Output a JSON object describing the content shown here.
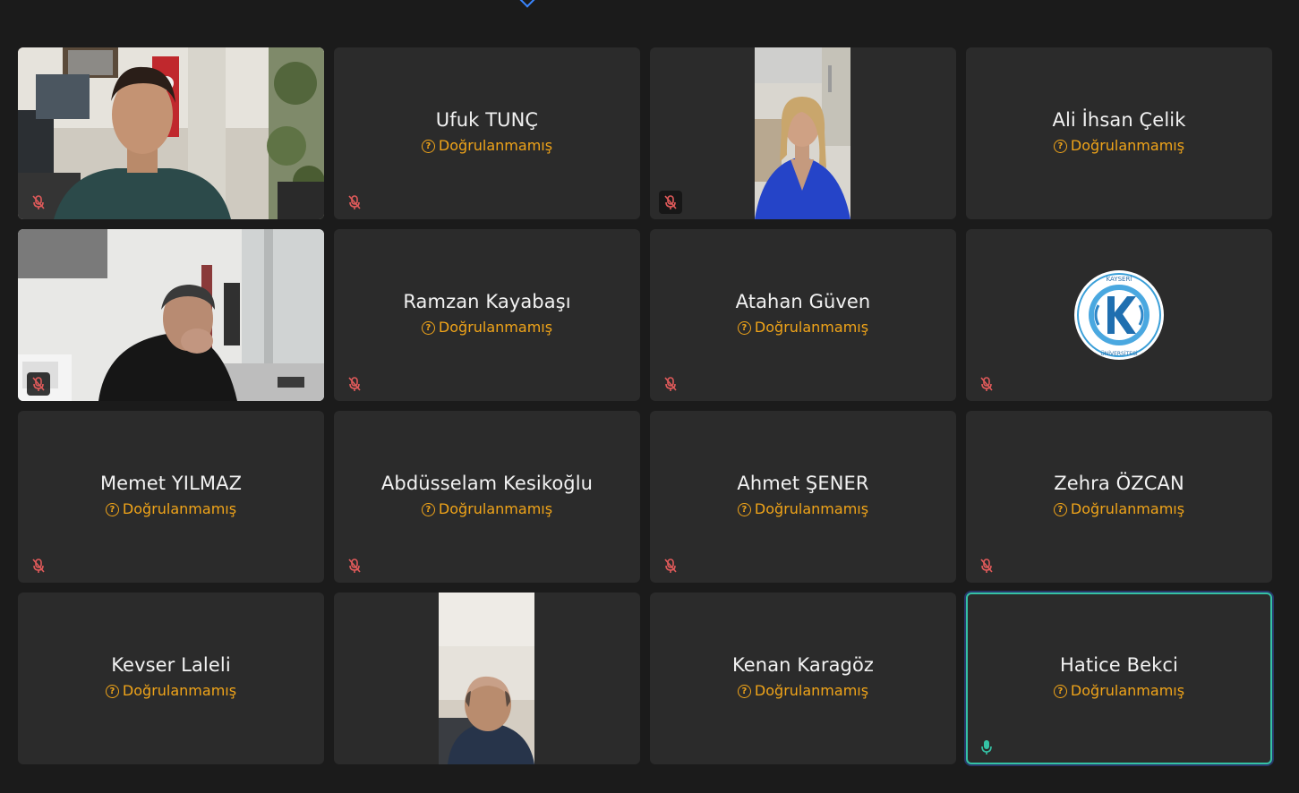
{
  "unverified_label": "Doğrulanmamış",
  "colors": {
    "background": "#1b1b1b",
    "tile": "#2b2b2b",
    "unverified": "#f0a419",
    "muted_mic": "#e05a5a",
    "active_mic": "#35c2a5",
    "active_border": "#35c2a5"
  },
  "participants": [
    {
      "name": "",
      "video": "man-office-flag",
      "mic": "muted-icon"
    },
    {
      "name": "Ufuk TUNÇ",
      "status": "Doğrulanmamış",
      "mic": "muted-icon"
    },
    {
      "name": "",
      "video": "woman-blue-dress-portrait",
      "mic": "muted-icon"
    },
    {
      "name": "Ali İhsan Çelik",
      "status": "Doğrulanmamış",
      "mic": "none"
    },
    {
      "name": "",
      "video": "man-black-shirt-office",
      "mic": "muted-icon"
    },
    {
      "name": "Ramzan Kayabaşı",
      "status": "Doğrulanmamış",
      "mic": "muted-icon"
    },
    {
      "name": "Atahan Güven",
      "status": "Doğrulanmamış",
      "mic": "muted-icon"
    },
    {
      "name": "",
      "logo": "kayseri-universitesi-logo",
      "logo_text": "KAYSERİ ÜNİVERSİTESİ",
      "mic": "muted-icon"
    },
    {
      "name": "Memet YILMAZ",
      "status": "Doğrulanmamış",
      "mic": "muted-icon"
    },
    {
      "name": "Abdüsselam Kesikoğlu",
      "status": "Doğrulanmamış",
      "mic": "muted-icon"
    },
    {
      "name": "Ahmet ŞENER",
      "status": "Doğrulanmamış",
      "mic": "muted-icon"
    },
    {
      "name": "Zehra ÖZCAN",
      "status": "Doğrulanmamış",
      "mic": "muted-icon"
    },
    {
      "name": "Kevser Laleli",
      "status": "Doğrulanmamış",
      "mic": "none"
    },
    {
      "name": "",
      "video": "bald-man-portrait",
      "mic": "none"
    },
    {
      "name": "Kenan Karagöz",
      "status": "Doğrulanmamış",
      "mic": "none"
    },
    {
      "name": "Hatice Bekci",
      "status": "Doğrulanmamış",
      "mic": "active-mic-icon",
      "speaking": true
    }
  ]
}
